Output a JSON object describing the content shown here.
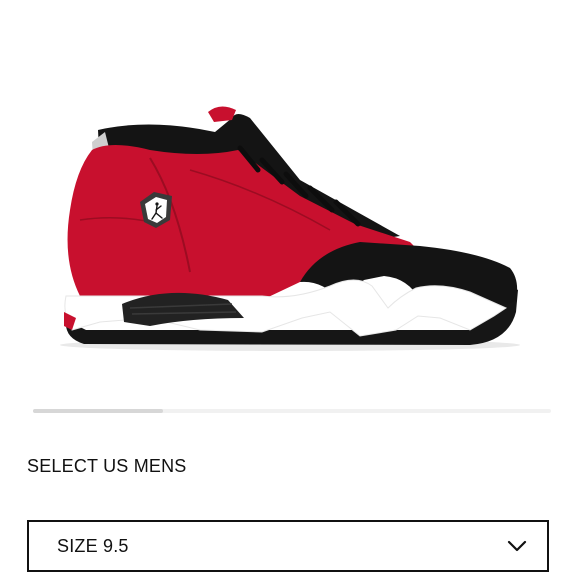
{
  "product": {
    "image_icon": "sneaker-image",
    "colors": {
      "upper": "#c8102e",
      "overlay": "#141414",
      "midsole": "#ffffff",
      "outsole": "#161616",
      "heel_tab": "#cfcfcf"
    }
  },
  "gallery": {
    "position": 1,
    "total": 4
  },
  "size_selector": {
    "heading": "SELECT US MENS",
    "selected": "SIZE 9.5",
    "chevron_icon": "chevron-down-icon"
  }
}
